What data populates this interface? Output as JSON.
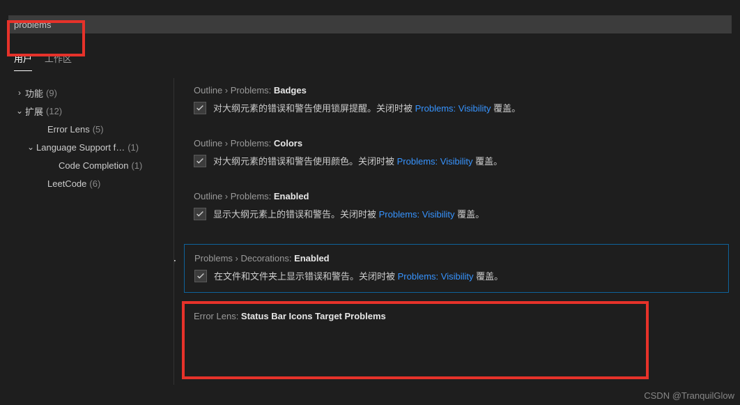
{
  "search": {
    "value": "problems"
  },
  "tabs": {
    "user": "用户",
    "workspace": "工作区"
  },
  "sidebar": {
    "items": [
      {
        "chev": "›",
        "label": "功能",
        "count": "(9)"
      },
      {
        "chev": "⌄",
        "label": "扩展",
        "count": "(12)"
      },
      {
        "chev": "",
        "label": "Error Lens",
        "count": "(5)"
      },
      {
        "chev": "⌄",
        "label": "Language Support f…",
        "count": "(1)"
      },
      {
        "chev": "",
        "label": "Code Completion",
        "count": "(1)"
      },
      {
        "chev": "",
        "label": "LeetCode",
        "count": "(6)"
      }
    ]
  },
  "settings": {
    "s0": {
      "path": "Outline › Problems: ",
      "name": "Badges",
      "desc_pre": "对大纲元素的错误和警告使用锁屏提醒。关闭时被 ",
      "link": "Problems: Visibility",
      "desc_post": " 覆盖。"
    },
    "s1": {
      "path": "Outline › Problems: ",
      "name": "Colors",
      "desc_pre": "对大纲元素的错误和警告使用颜色。关闭时被 ",
      "link": "Problems: Visibility",
      "desc_post": " 覆盖。"
    },
    "s2": {
      "path": "Outline › Problems: ",
      "name": "Enabled",
      "desc_pre": "显示大纲元素上的错误和警告。关闭时被 ",
      "link": "Problems: Visibility",
      "desc_post": " 覆盖。"
    },
    "s3": {
      "path": "Problems › Decorations: ",
      "name": "Enabled",
      "desc_pre": "在文件和文件夹上显示错误和警告。关闭时被 ",
      "link": "Problems: Visibility",
      "desc_post": " 覆盖。"
    },
    "s4": {
      "path": "Error Lens: ",
      "name": "Status Bar Icons Target Problems"
    }
  },
  "watermark": "CSDN @TranquilGlow"
}
